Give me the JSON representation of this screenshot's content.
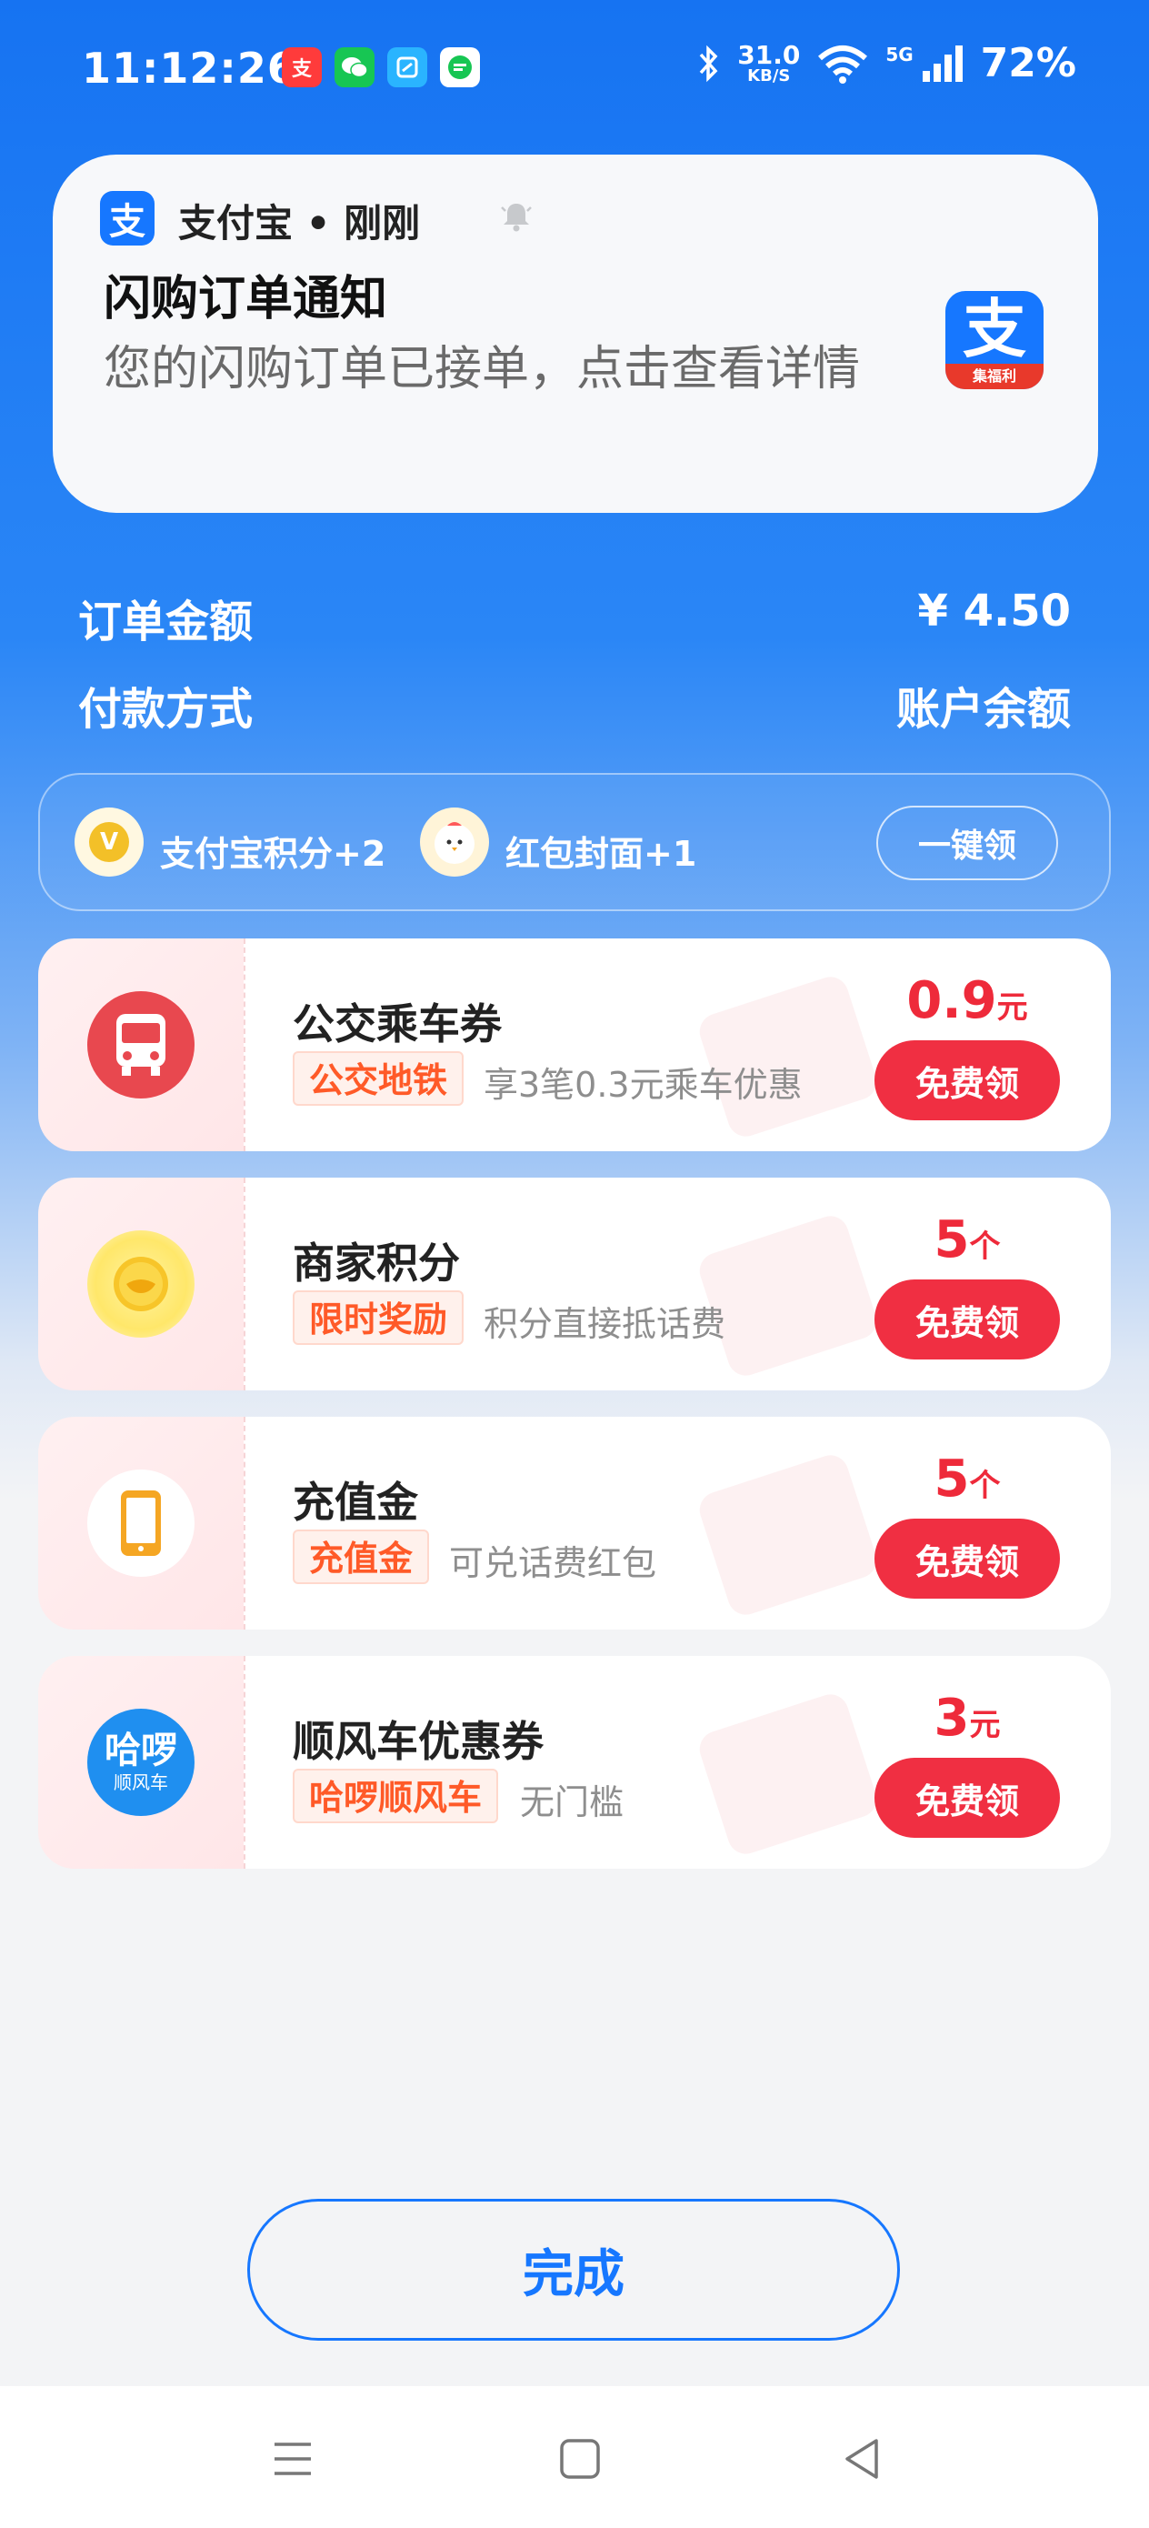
{
  "status_bar": {
    "time": "11:12:26",
    "net_speed_value": "31.0",
    "net_speed_unit": "KB/S",
    "network": "5G",
    "battery": "72%"
  },
  "notification": {
    "app_name": "支付宝 • 刚刚",
    "title": "闪购订单通知",
    "body": "您的闪购订单已接单，点击查看详情",
    "big_icon_char": "支",
    "big_icon_band": "集福利"
  },
  "order": {
    "amount_label": "订单金额",
    "amount_value": "¥ 4.50",
    "method_label": "付款方式",
    "method_value": "账户余额"
  },
  "rewards": {
    "item1": "支付宝积分+2",
    "item2": "红包封面+1",
    "claim_all": "一键领"
  },
  "coupons": [
    {
      "title": "公交乘车券",
      "tag": "公交地铁",
      "desc": "享3笔0.3元乘车优惠",
      "amount": "0.9",
      "unit": "元",
      "button": "免费领"
    },
    {
      "title": "商家积分",
      "tag": "限时奖励",
      "desc": "积分直接抵话费",
      "amount": "5",
      "unit": "个",
      "button": "免费领"
    },
    {
      "title": "充值金",
      "tag": "充值金",
      "desc": "可兑话费红包",
      "amount": "5",
      "unit": "个",
      "button": "免费领"
    },
    {
      "title": "顺风车优惠券",
      "tag": "哈啰顺风车",
      "desc": "无门槛",
      "amount": "3",
      "unit": "元",
      "button": "免费领",
      "icon_text": "哈啰",
      "icon_sub": "顺风车"
    }
  ],
  "done_button": "完成",
  "colors": {
    "brand_blue": "#1677ff",
    "accent_red": "#f02f42",
    "tag_orange": "#ff5a28"
  }
}
